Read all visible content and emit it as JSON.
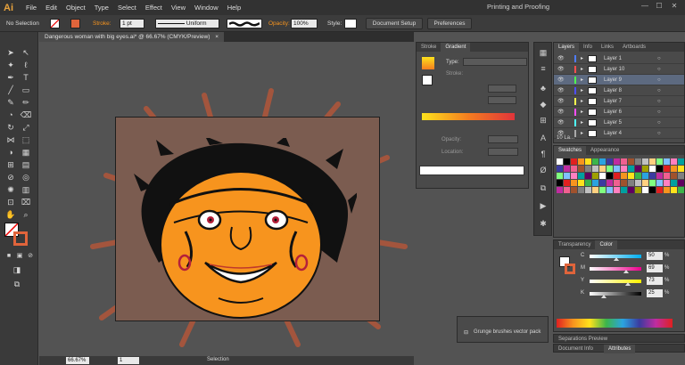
{
  "app": {
    "logo": "Ai",
    "workspace": "Printing and Proofing",
    "win_min": "—",
    "win_max": "☐",
    "win_close": "✕"
  },
  "menu": [
    "File",
    "Edit",
    "Object",
    "Type",
    "Select",
    "Effect",
    "View",
    "Window",
    "Help"
  ],
  "control": {
    "selection_state": "No Selection",
    "stroke_label": "Stroke:",
    "stroke_weight": "1 pt",
    "stroke_profile": "Uniform",
    "opacity_label": "Opacity:",
    "opacity_value": "100%",
    "style_label": "Style:",
    "document_setup": "Document Setup",
    "preferences": "Preferences"
  },
  "document": {
    "tab_title": "Dangerous woman with big eyes.ai* @ 66.67% (CMYK/Preview)",
    "tab_close": "×"
  },
  "status": {
    "zoom": "66.67%",
    "artboard_number": "1",
    "tool_name": "Selection"
  },
  "gradient_panel": {
    "tabs": [
      "Stroke",
      "Gradient"
    ],
    "type_label": "Type:",
    "stroke_label": "Stroke:",
    "opacity_label": "Opacity:",
    "location_label": "Location:"
  },
  "layers_panel": {
    "tabs": [
      "Layers",
      "Info",
      "Links",
      "Artboards"
    ],
    "layers": [
      {
        "name": "Layer 1",
        "color": "#4f7cff"
      },
      {
        "name": "Layer 10",
        "color": "#ff4f4f"
      },
      {
        "name": "Layer 9",
        "color": "#4fff4f"
      },
      {
        "name": "Layer 8",
        "color": "#4f4fff"
      },
      {
        "name": "Layer 7",
        "color": "#ffff4f"
      },
      {
        "name": "Layer 6",
        "color": "#ff4fff"
      },
      {
        "name": "Layer 5",
        "color": "#4fffff"
      },
      {
        "name": "Layer 4",
        "color": "#aaaaaa"
      }
    ],
    "count": "10 La..."
  },
  "swatches_panel": {
    "tabs": [
      "Swatches",
      "Appearance"
    ]
  },
  "color_panel": {
    "tabs": [
      "Transparency",
      "Color"
    ],
    "channels": [
      {
        "label": "C",
        "value": "50"
      },
      {
        "label": "M",
        "value": "69"
      },
      {
        "label": "Y",
        "value": "73"
      },
      {
        "label": "K",
        "value": "25"
      }
    ]
  },
  "separations_panel": {
    "title": "Separations Preview"
  },
  "document_info_panel": {
    "tabs": [
      "Document Info",
      "Attributes"
    ]
  },
  "brush_popup": {
    "label": "Grunge brushes vector pack"
  },
  "colors": {
    "accent": "#f7941e",
    "panel": "#4a4a4a",
    "bg": "#535353"
  }
}
